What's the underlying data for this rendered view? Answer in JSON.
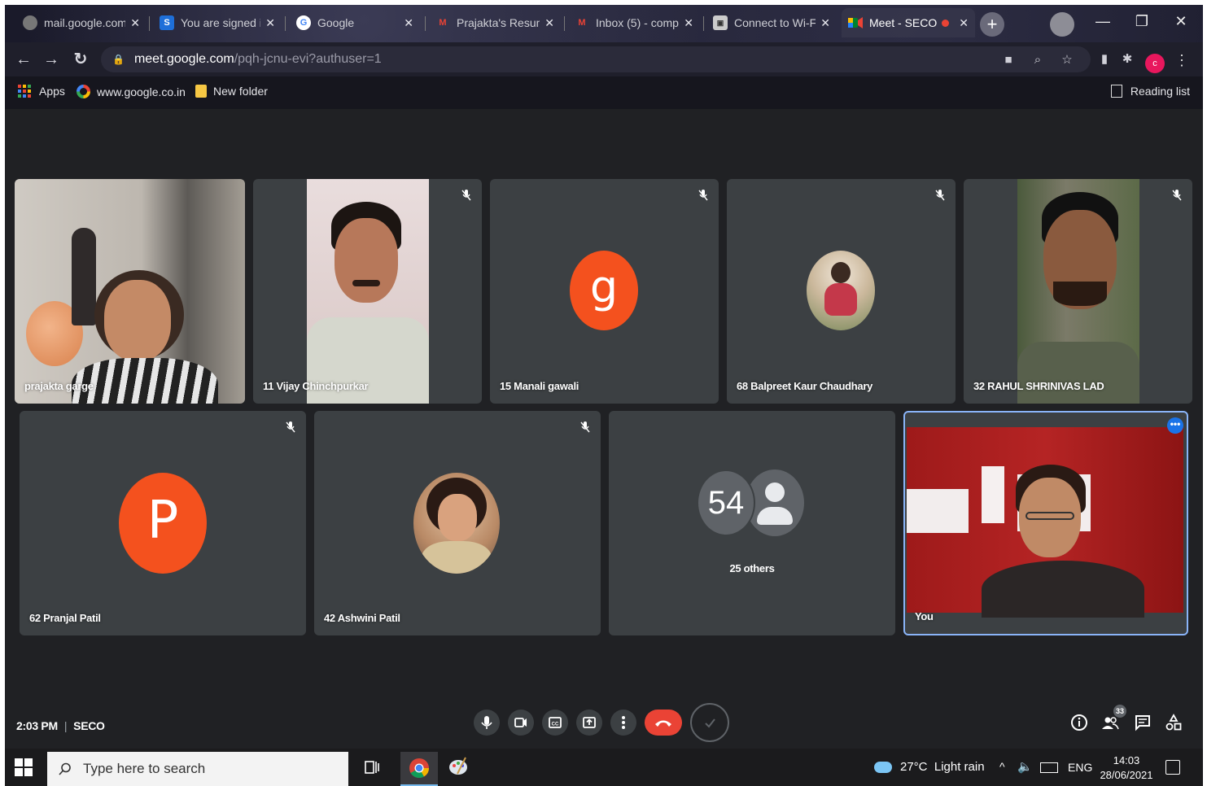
{
  "browser": {
    "tabs": [
      {
        "title": "mail.google.com",
        "favicon": "globe-icon"
      },
      {
        "title": "You are signed in",
        "favicon": "s-icon"
      },
      {
        "title": "Google",
        "favicon": "google-icon"
      },
      {
        "title": "Prajakta's Resume",
        "favicon": "gmail-icon"
      },
      {
        "title": "Inbox (5) - comp",
        "favicon": "gmail-icon"
      },
      {
        "title": "Connect to Wi-Fi",
        "favicon": "wifi-icon"
      },
      {
        "title": "Meet - SECO",
        "favicon": "meet-icon",
        "active": true
      }
    ],
    "new_tab_label": "+",
    "url_host": "meet.google.com",
    "url_path": "/pqh-jcnu-evi?authuser=1",
    "profile_initial": "c",
    "bookmarks": [
      {
        "label": "Apps",
        "icon": "apps-grid-icon"
      },
      {
        "label": "www.google.co.in",
        "icon": "google-icon"
      },
      {
        "label": "New folder",
        "icon": "folder-icon"
      }
    ],
    "reading_list_label": "Reading list"
  },
  "meet": {
    "participants_row1": [
      {
        "name": "prajakta garge",
        "type": "video",
        "muted": false
      },
      {
        "name": "11 Vijay Chinchpurkar",
        "type": "video",
        "muted": true
      },
      {
        "name": "15 Manali gawali",
        "type": "letter",
        "letter": "g",
        "color": "#f4511e",
        "muted": true
      },
      {
        "name": "68 Balpreet Kaur Chaudhary",
        "type": "photo",
        "muted": true
      },
      {
        "name": "32 RAHUL SHRINIVAS LAD",
        "type": "video",
        "muted": true
      }
    ],
    "participants_row2": [
      {
        "name": "62 Pranjal Patil",
        "type": "letter",
        "letter": "P",
        "color": "#f4511e",
        "muted": true
      },
      {
        "name": "42 Ashwini Patil",
        "type": "photo",
        "muted": true
      },
      {
        "name": "25 others",
        "type": "others",
        "count": "54"
      },
      {
        "name": "You",
        "type": "self-video"
      }
    ],
    "time": "2:03 PM",
    "meeting_name": "SECO",
    "participant_count_badge": "33",
    "accent_color": "#8ab4f8",
    "hangup_color": "#ea4335"
  },
  "taskbar": {
    "search_placeholder": "Type here to search",
    "weather_temp": "27°C",
    "weather_desc": "Light rain",
    "language": "ENG",
    "clock_time": "14:03",
    "clock_date": "28/06/2021"
  }
}
